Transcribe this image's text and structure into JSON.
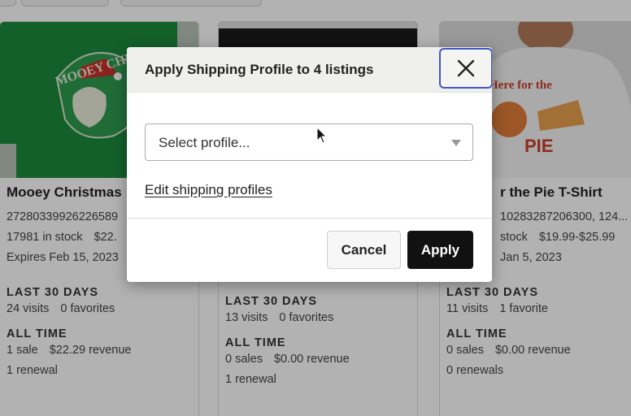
{
  "modal": {
    "title": "Apply Shipping Profile to 4 listings",
    "select_placeholder": "Select profile...",
    "edit_link": "Edit shipping profiles",
    "cancel_label": "Cancel",
    "apply_label": "Apply",
    "accent_color": "#3f57c4"
  },
  "listings": [
    {
      "title": "Mooey Christmas",
      "id_line": "27280339926226589",
      "stock": "17981 in stock",
      "price": "$22.",
      "expires": "Expires Feb 15, 2023",
      "last30_heading": "LAST 30 DAYS",
      "last30_visits": "24 visits",
      "last30_favorites": "0 favorites",
      "alltime_heading": "ALL TIME",
      "sales": "1 sale",
      "revenue": "$22.29 revenue",
      "renewals": "1 renewal"
    },
    {
      "title": "",
      "id_line": "",
      "stock": "",
      "price": "",
      "expires": "",
      "last30_heading": "LAST 30 DAYS",
      "last30_visits": "13 visits",
      "last30_favorites": "0 favorites",
      "alltime_heading": "ALL TIME",
      "sales": "0 sales",
      "revenue": "$0.00 revenue",
      "renewals": "1 renewal"
    },
    {
      "title": "r the Pie T-Shirt",
      "id_line": "10283287206300, 124...",
      "stock": "stock",
      "price": "$19.99-$25.99",
      "expires": "Jan 5, 2023",
      "last30_heading": "LAST 30 DAYS",
      "last30_visits": "11 visits",
      "last30_favorites": "1 favorite",
      "alltime_heading": "ALL TIME",
      "sales": "0 sales",
      "revenue": "$0.00 revenue",
      "renewals": "0 renewals"
    }
  ],
  "images": {
    "card1_text": "MOOEY CHRIS",
    "card3_text_top": "Here for the",
    "card3_text_bottom": "PIE"
  }
}
